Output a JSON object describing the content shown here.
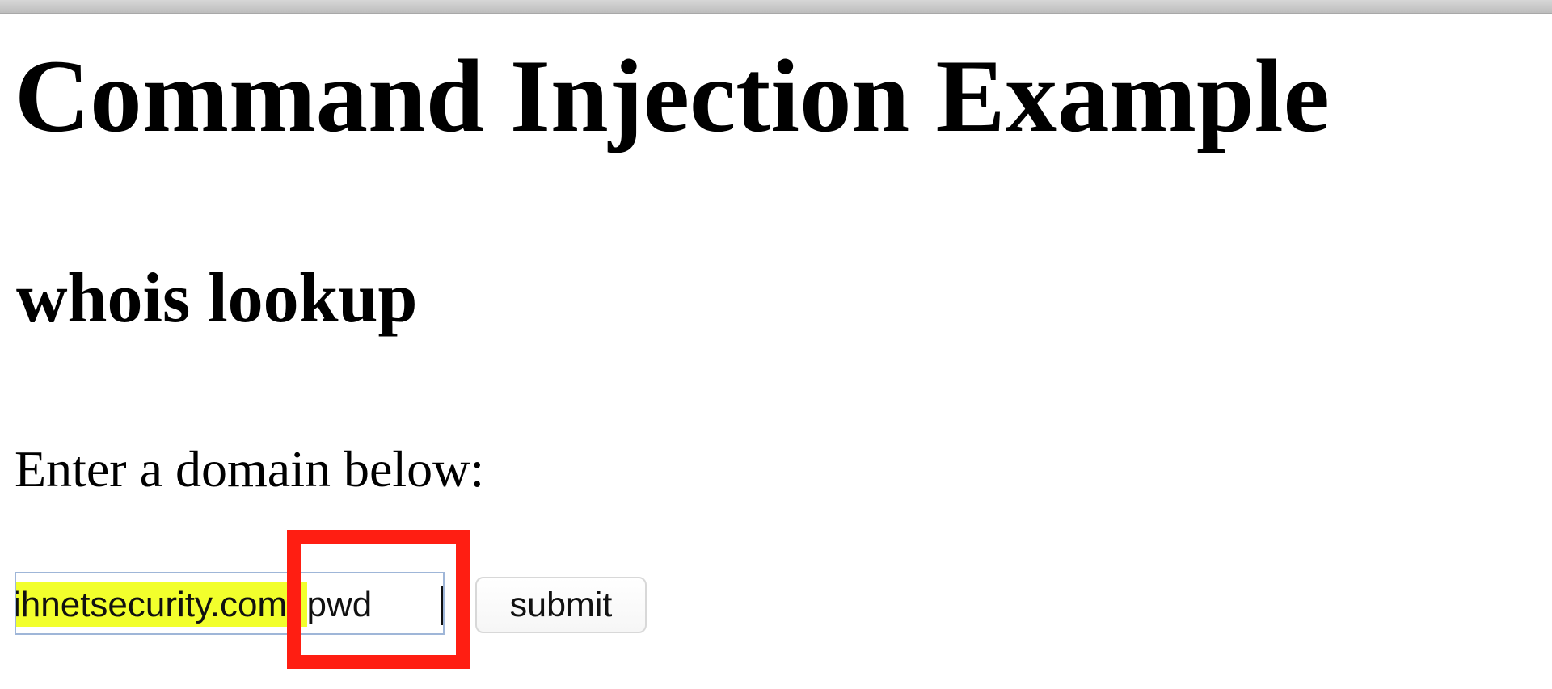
{
  "page": {
    "title": "Command Injection Example",
    "subtitle": "whois lookup",
    "prompt": "Enter a domain below:"
  },
  "form": {
    "domain_value": "ihnetsecurity.com; pwd",
    "submit_label": "submit"
  },
  "colors": {
    "annotation_red": "#ff1e12",
    "input_highlight": "#f2ff2c",
    "input_border": "#9fb6d8"
  }
}
